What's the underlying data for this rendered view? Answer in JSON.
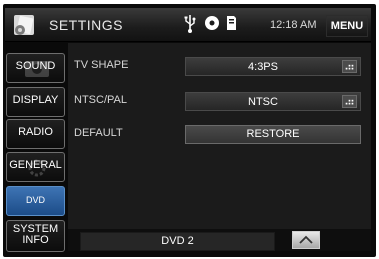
{
  "header": {
    "title": "SETTINGS",
    "clock": "12:18 AM",
    "menu_label": "MENU"
  },
  "sidebar": {
    "tabs": [
      {
        "label": "SOUND",
        "active": false
      },
      {
        "label": "DISPLAY",
        "active": false
      },
      {
        "label": "RADIO",
        "active": false
      },
      {
        "label": "GENERAL",
        "active": false
      },
      {
        "label": "DVD",
        "active": true
      },
      {
        "label": "SYSTEM\nINFO",
        "active": false
      }
    ]
  },
  "settings": {
    "tv_shape": {
      "label": "TV SHAPE",
      "value": "4:3PS"
    },
    "ntsc_pal": {
      "label": "NTSC/PAL",
      "value": "NTSC"
    },
    "default": {
      "label": "DEFAULT",
      "button": "RESTORE"
    }
  },
  "status_bar": {
    "source": "DVD 2"
  },
  "colors": {
    "active_tab": "#2c64a8",
    "background": "#0a0a0a"
  },
  "icons": [
    "settings-logo-icon",
    "usb-icon",
    "disc-icon",
    "sd-card-icon",
    "list-icon",
    "up-arrow-icon"
  ]
}
